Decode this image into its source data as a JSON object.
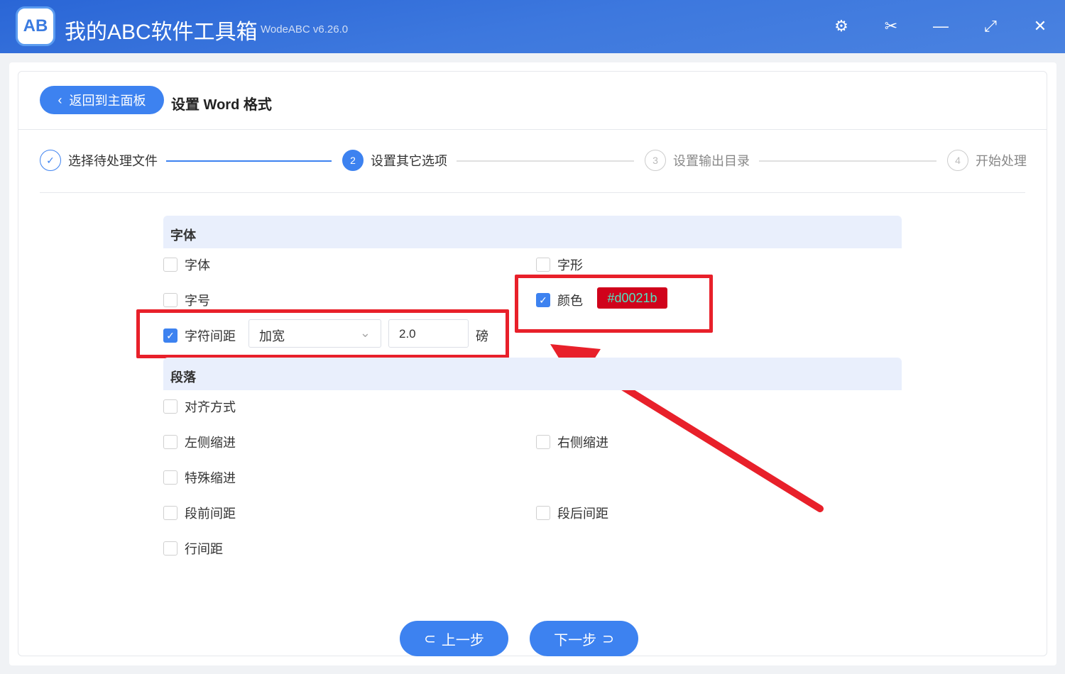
{
  "app": {
    "title": "我的ABC软件工具箱",
    "version": "WodeABC v6.26.0",
    "logo_text": "AB"
  },
  "header": {
    "back_label": "返回到主面板",
    "page_title": "设置 Word 格式"
  },
  "steps": [
    {
      "label": "选择待处理文件",
      "num": "✓"
    },
    {
      "label": "设置其它选项",
      "num": "2"
    },
    {
      "label": "设置输出目录",
      "num": "3"
    },
    {
      "label": "开始处理",
      "num": "4"
    }
  ],
  "font_section": {
    "title": "字体",
    "font": "字体",
    "style": "字形",
    "size": "字号",
    "color": "颜色",
    "color_value": "#d0021b",
    "spacing": "字符间距",
    "spacing_mode": "加宽",
    "spacing_value": "2.0",
    "spacing_unit": "磅"
  },
  "para_section": {
    "title": "段落",
    "align": "对齐方式",
    "left_indent": "左侧缩进",
    "right_indent": "右侧缩进",
    "special_indent": "特殊缩进",
    "before": "段前间距",
    "after": "段后间距",
    "line": "行间距"
  },
  "footer": {
    "prev": "上一步",
    "next": "下一步"
  }
}
